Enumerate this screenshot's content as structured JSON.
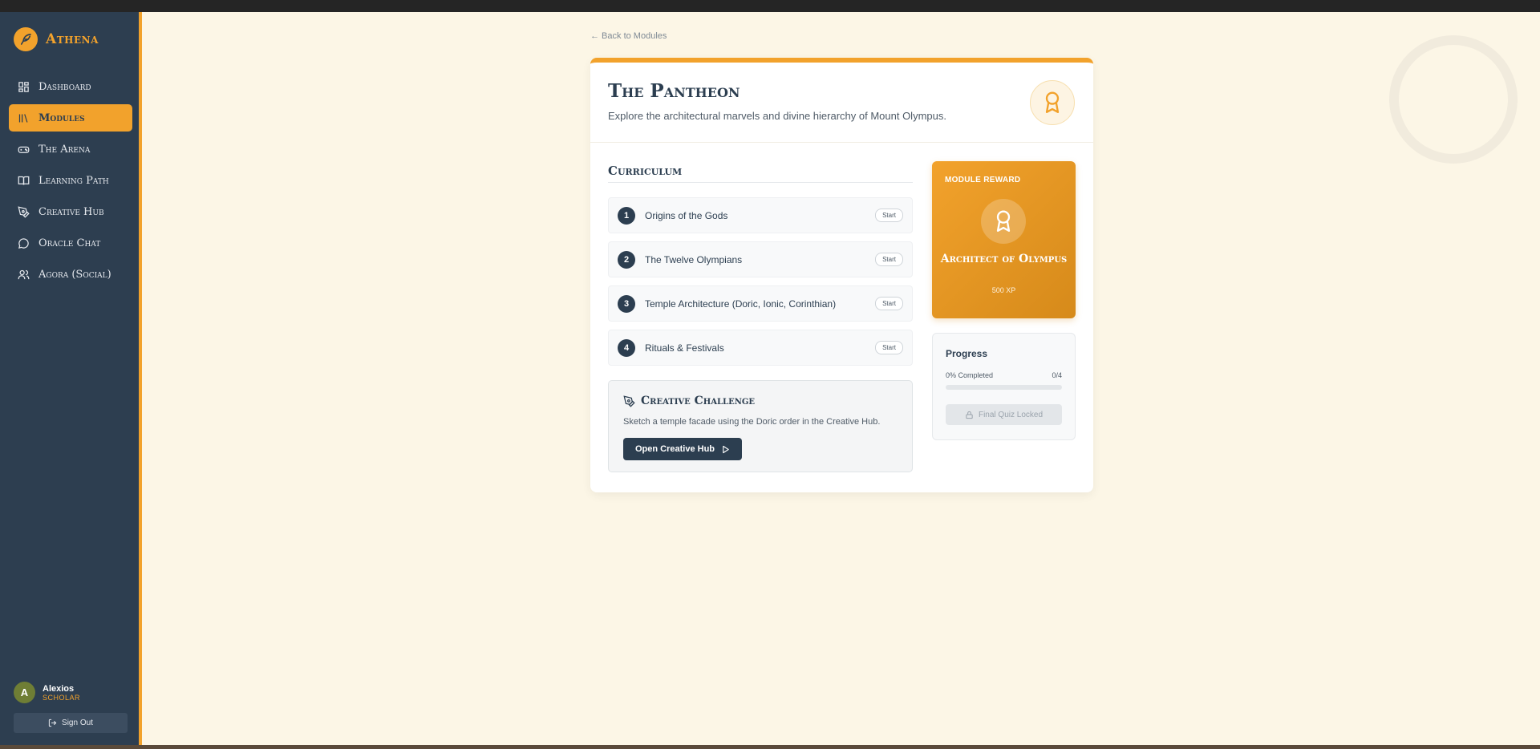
{
  "app": {
    "name": "Athena"
  },
  "sidebar": {
    "items": [
      {
        "label": "Dashboard",
        "icon": "dashboard-icon",
        "active": false
      },
      {
        "label": "Modules",
        "icon": "library-icon",
        "active": true
      },
      {
        "label": "The Arena",
        "icon": "gamepad-icon",
        "active": false
      },
      {
        "label": "Learning Path",
        "icon": "book-icon",
        "active": false
      },
      {
        "label": "Creative Hub",
        "icon": "pen-tool-icon",
        "active": false
      },
      {
        "label": "Oracle Chat",
        "icon": "chat-icon",
        "active": false
      },
      {
        "label": "Agora (Social)",
        "icon": "users-icon",
        "active": false
      }
    ],
    "user": {
      "initial": "A",
      "name": "Alexios",
      "role": "SCHOLAR"
    },
    "signout_label": "Sign Out"
  },
  "back_link": "← Back to Modules",
  "module": {
    "title": "The Pantheon",
    "subtitle": "Explore the architectural marvels and divine hierarchy of Mount Olympus."
  },
  "curriculum": {
    "title": "Curriculum",
    "start_label": "Start",
    "lessons": [
      {
        "num": "1",
        "title": "Origins of the Gods"
      },
      {
        "num": "2",
        "title": "The Twelve Olympians"
      },
      {
        "num": "3",
        "title": "Temple Architecture (Doric, Ionic, Corinthian)"
      },
      {
        "num": "4",
        "title": "Rituals & Festivals"
      }
    ]
  },
  "challenge": {
    "title": "Creative Challenge",
    "description": "Sketch a temple facade using the Doric order in the Creative Hub.",
    "button": "Open Creative Hub"
  },
  "reward": {
    "label": "MODULE REWARD",
    "name": "Architect of Olympus",
    "xp": "500 XP"
  },
  "progress": {
    "title": "Progress",
    "percent_label": "0% Completed",
    "count": "0/4",
    "fraction": 0,
    "quiz_label": "Final Quiz Locked"
  },
  "colors": {
    "accent": "#f2a22c",
    "sidebar": "#2d3e50",
    "background": "#fcf6e6"
  }
}
